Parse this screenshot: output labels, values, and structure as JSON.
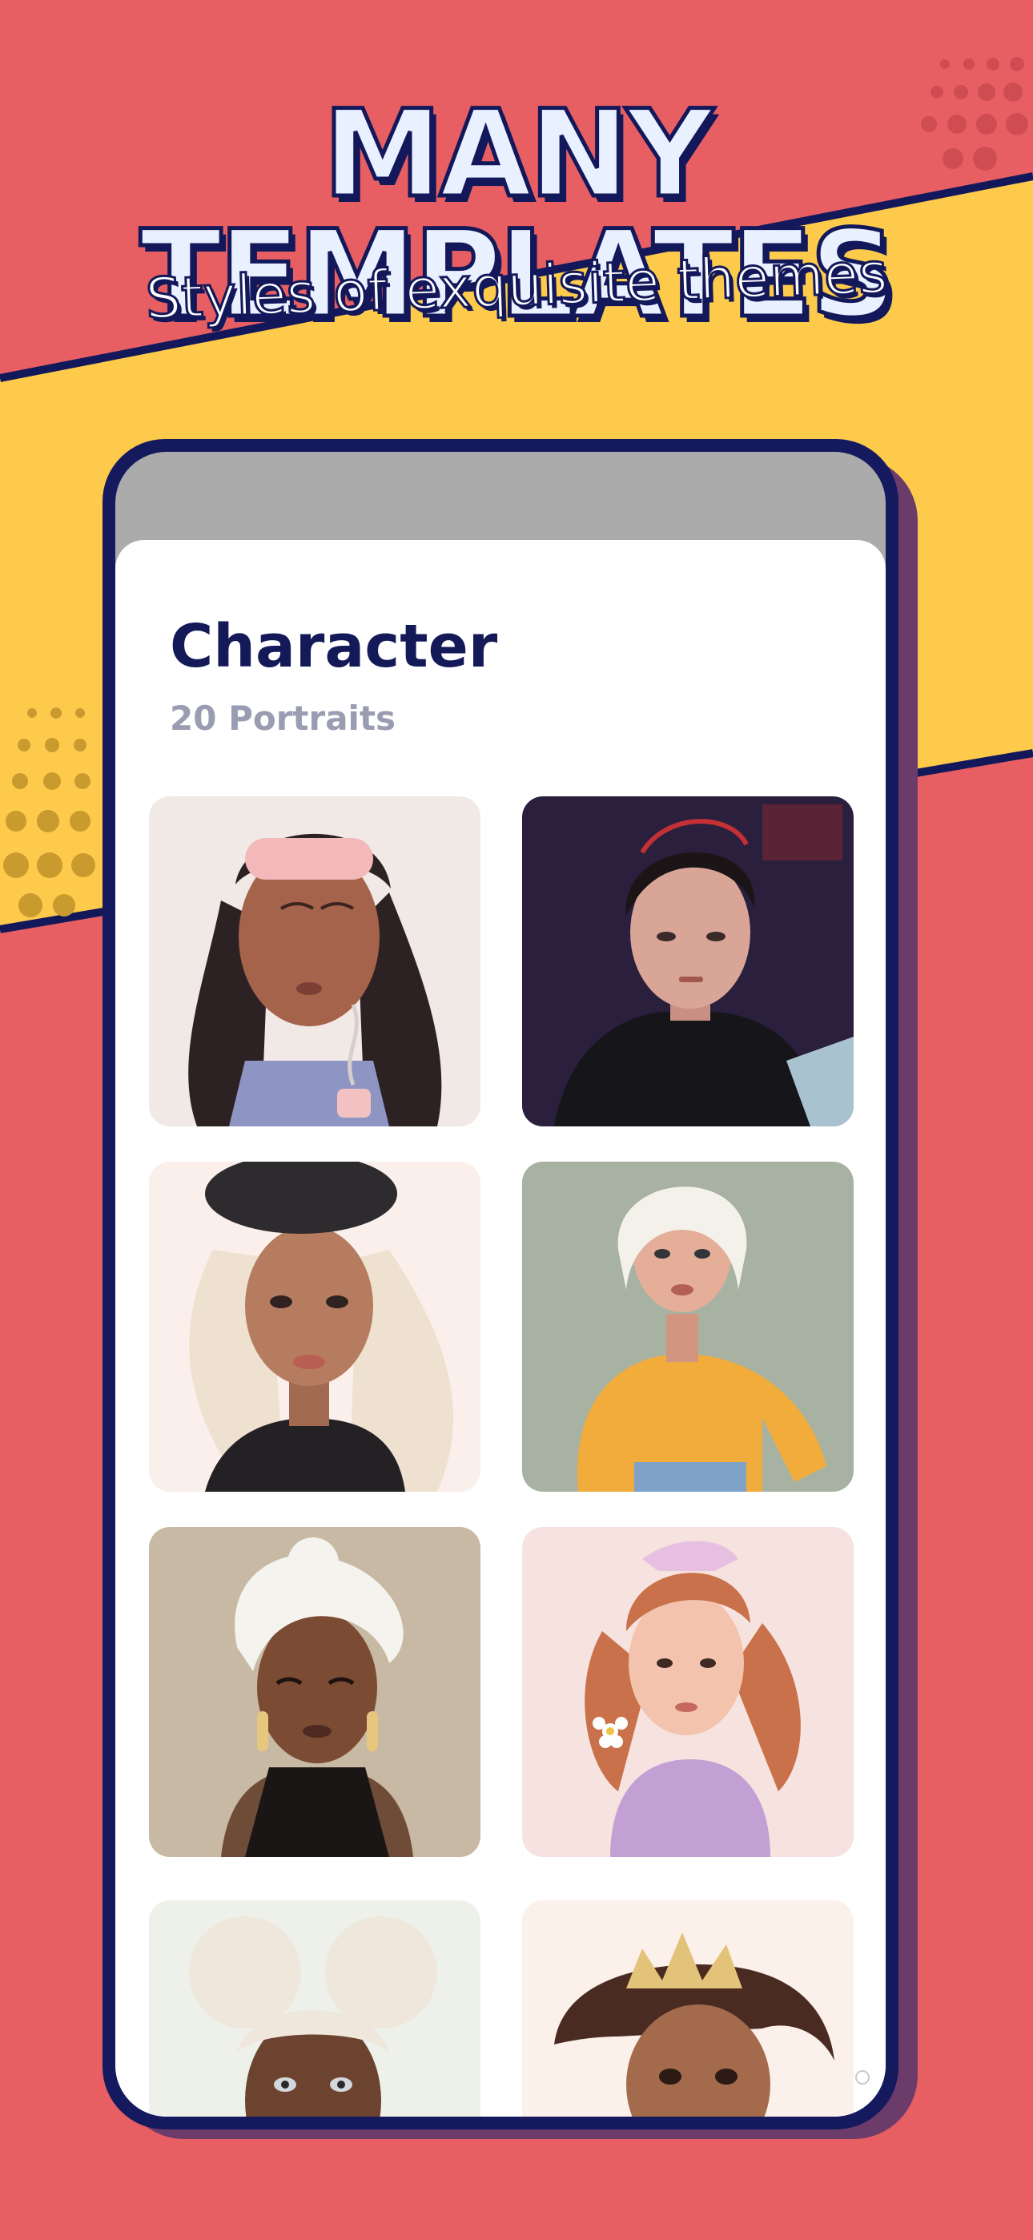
{
  "banner": {
    "headline": "MANY TEMPLATES",
    "subline": "Styles of exquisite themes"
  },
  "colors": {
    "background_red": "#e85f63",
    "accent_yellow": "#fdca4c",
    "navy": "#12185a",
    "title_text": "#141a58",
    "subtitle_text": "#9a9cb1"
  },
  "screen": {
    "title": "Character",
    "subtitle": "20  Portraits",
    "portraits": [
      {
        "name": "portrait-sleep-mask-girl",
        "bg": "#f1e9e5"
      },
      {
        "name": "portrait-hoodie-boy",
        "bg": "#2a1f3d"
      },
      {
        "name": "portrait-beret-girl",
        "bg": "#fbefec"
      },
      {
        "name": "portrait-yellow-sweater-girl",
        "bg": "#a7b2a3"
      },
      {
        "name": "portrait-white-bun-girl",
        "bg": "#c8b9a4"
      },
      {
        "name": "portrait-daisy-girl",
        "bg": "#f6e3df"
      },
      {
        "name": "portrait-double-bun-girl",
        "bg": "#eef0ea"
      },
      {
        "name": "portrait-crown-girl",
        "bg": "#fbf1ea"
      }
    ]
  }
}
